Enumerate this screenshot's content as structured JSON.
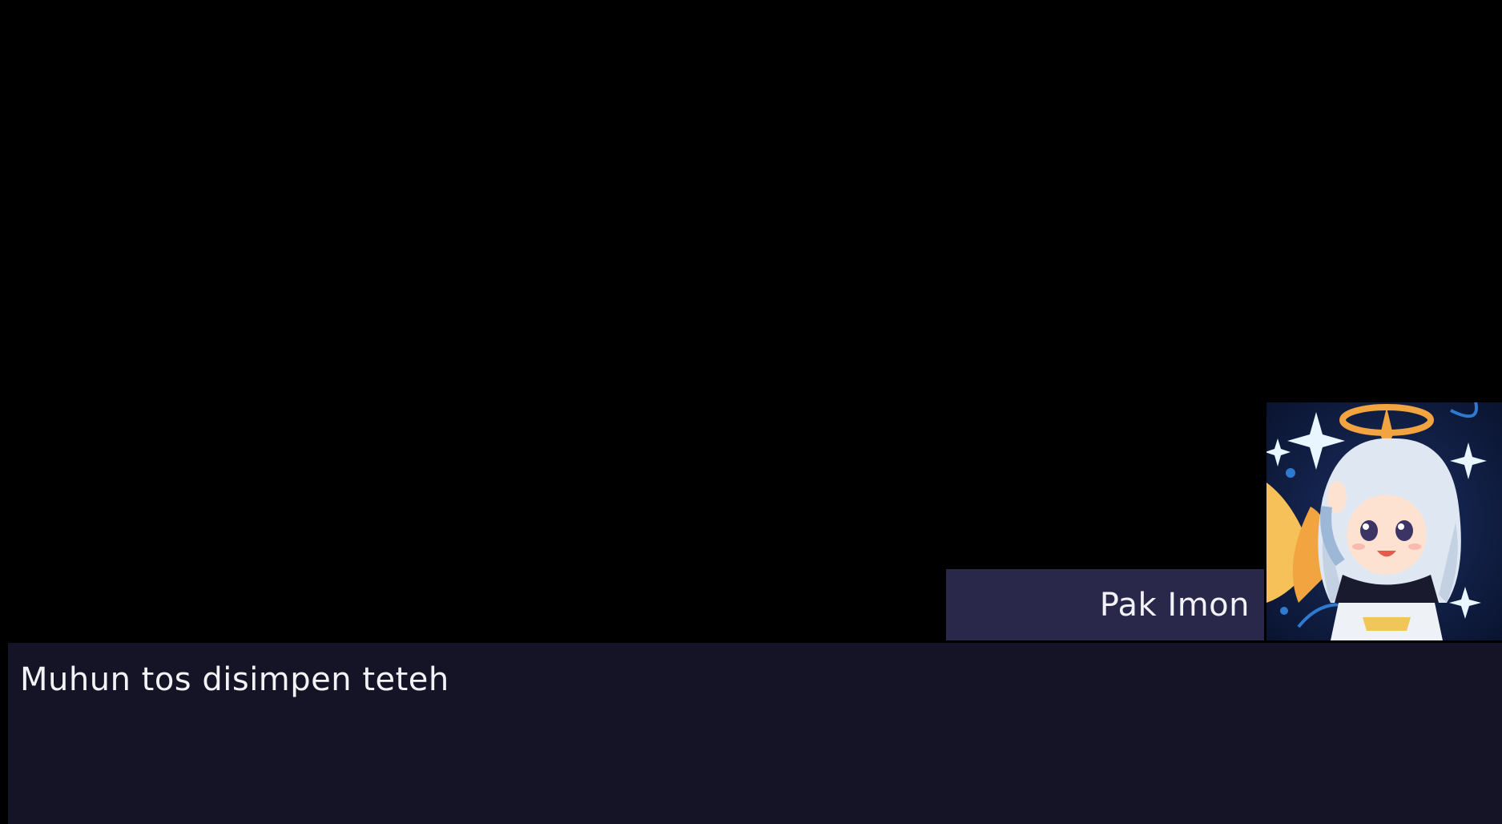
{
  "speaker": {
    "name": "Pak Imon",
    "portrait_icon": "character-portrait-icon"
  },
  "dialog": {
    "text": "Muhun tos disimpen teteh"
  },
  "colors": {
    "background": "#000000",
    "name_plate": "#29284a",
    "dialog_box": "#141426",
    "text": "#f2f2f7"
  }
}
